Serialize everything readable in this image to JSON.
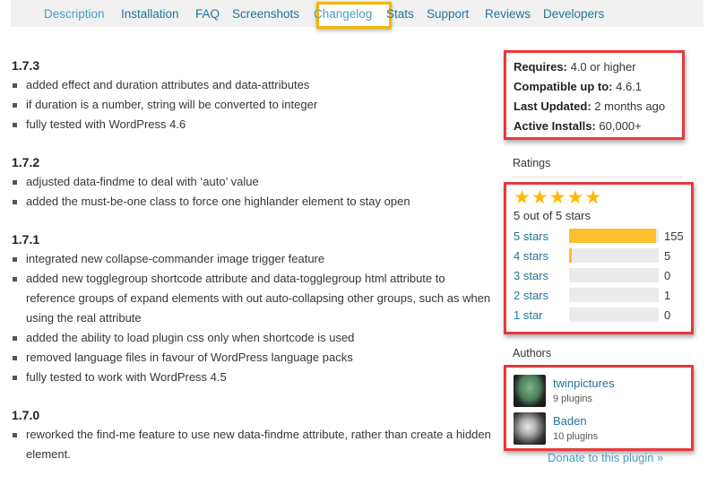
{
  "nav": {
    "tabs": [
      {
        "label": "Description"
      },
      {
        "label": "Installation"
      },
      {
        "label": "FAQ"
      },
      {
        "label": "Screenshots"
      },
      {
        "label": "Changelog",
        "active": true
      },
      {
        "label": "Stats"
      },
      {
        "label": "Support"
      },
      {
        "label": "Reviews"
      },
      {
        "label": "Developers"
      }
    ],
    "highlight_color": "#f4b400"
  },
  "changelog": [
    {
      "version": "1.7.3",
      "entries": [
        "added effect and duration attributes and data-attributes",
        "if duration is a number, string will be converted to integer",
        "fully tested with WordPress 4.6"
      ]
    },
    {
      "version": "1.7.2",
      "entries": [
        "adjusted data-findme to deal with ‘auto’ value",
        "added the must-be-one class to force one highlander element to stay open"
      ]
    },
    {
      "version": "1.7.1",
      "entries": [
        "integrated new collapse-commander image trigger feature",
        "added new togglegroup shortcode attribute and data-togglegroup html attribute to reference groups of expand elements with out auto-collapsing other groups, such as when using the real attribute",
        "added the ability to load plugin css only when shortcode is used",
        "removed language files in favour of WordPress language packs",
        "fully tested to work with WordPress 4.5"
      ]
    },
    {
      "version": "1.7.0",
      "entries": [
        "reworked the find-me feature to use new data-findme attribute, rather than create a hidden element."
      ]
    }
  ],
  "meta": {
    "requires_label": "Requires:",
    "requires_value": "4.0 or higher",
    "compatible_label": "Compatible up to:",
    "compatible_value": "4.6.1",
    "updated_label": "Last Updated:",
    "updated_value": "2 months ago",
    "installs_label": "Active Installs:",
    "installs_value": "60,000+"
  },
  "ratings": {
    "title": "Ratings",
    "stars_filled": 5,
    "star_glyph": "★",
    "summary": "5 out of 5 stars",
    "rows": [
      {
        "label": "5 stars",
        "count": "155",
        "fraction": 0.97
      },
      {
        "label": "4 stars",
        "count": "5",
        "fraction": 0.03
      },
      {
        "label": "3 stars",
        "count": "0",
        "fraction": 0
      },
      {
        "label": "2 stars",
        "count": "1",
        "fraction": 0
      },
      {
        "label": "1 star",
        "count": "0",
        "fraction": 0
      }
    ],
    "bar_color": "#fcbf2f",
    "star_color": "#ffb900"
  },
  "authors": {
    "title": "Authors",
    "list": [
      {
        "name": "twinpictures",
        "plugins": "9 plugins",
        "avatar": "green-gem-avatar"
      },
      {
        "name": "Baden",
        "plugins": "10 plugins",
        "avatar": "person-photo-avatar"
      }
    ]
  },
  "donate": {
    "label": "Donate to this plugin »"
  },
  "annotation_box_color": "#e8383d"
}
